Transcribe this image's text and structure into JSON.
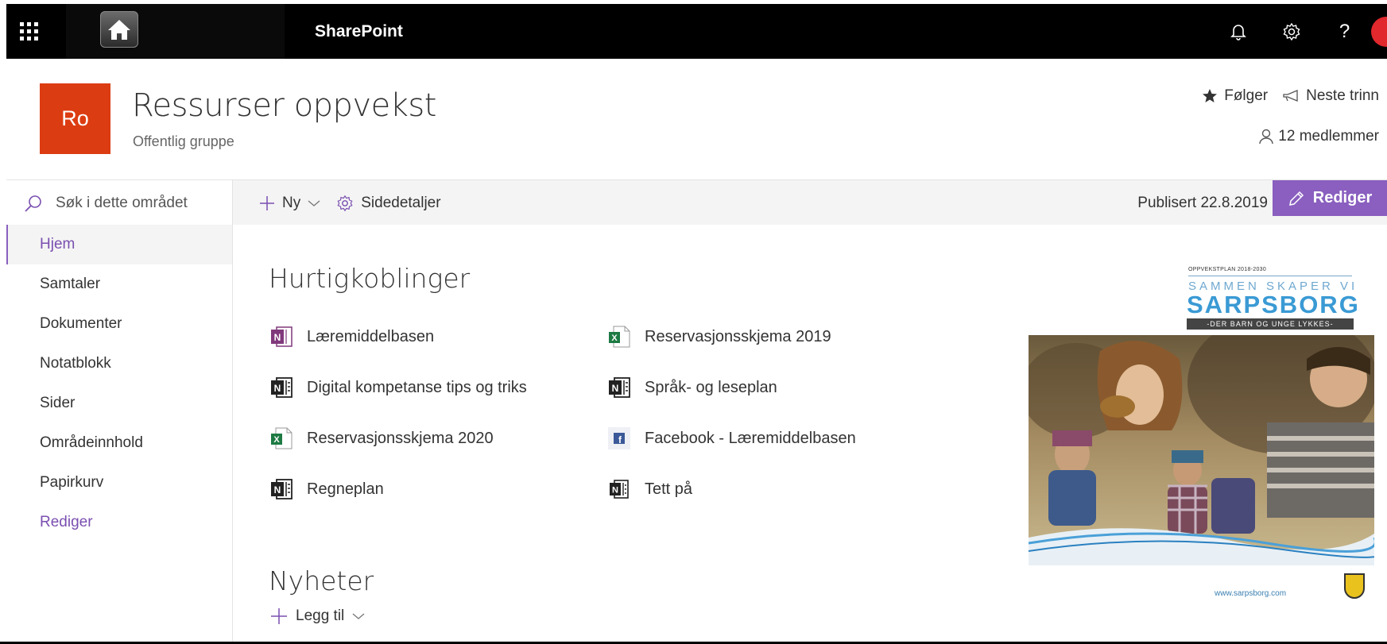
{
  "suitebar": {
    "title": "SharePoint",
    "icons": [
      "waffle-icon",
      "home-icon",
      "bell-icon",
      "gear-icon",
      "help-icon"
    ],
    "help_glyph": "?"
  },
  "site": {
    "logo_initials": "Ro",
    "logo_color": "#dc3c12",
    "title": "Ressurser oppvekst",
    "subtitle": "Offentlig gruppe",
    "follow_label": "Følger",
    "next_steps_label": "Neste trinn",
    "members_label": "12 medlemmer"
  },
  "commandbar": {
    "search_placeholder": "Søk i dette området",
    "new_label": "Ny",
    "page_details_label": "Sidedetaljer",
    "published_label": "Publisert 22.8.2019",
    "edit_label": "Rediger",
    "edit_color": "#8a5fbf"
  },
  "nav": {
    "items": [
      {
        "label": "Hjem",
        "active": true
      },
      {
        "label": "Samtaler"
      },
      {
        "label": "Dokumenter"
      },
      {
        "label": "Notatblokk"
      },
      {
        "label": "Sider"
      },
      {
        "label": "Områdeinnhold"
      },
      {
        "label": "Papirkurv"
      },
      {
        "label": "Rediger",
        "edit": true
      }
    ]
  },
  "quicklinks": {
    "heading": "Hurtigkoblinger",
    "links": [
      {
        "label": "Læremiddelbasen",
        "icon": "onenote-purple-icon"
      },
      {
        "label": "Reservasjonsskjema 2019",
        "icon": "excel-icon"
      },
      {
        "label": "Digital kompetanse tips og triks",
        "icon": "onenote-icon"
      },
      {
        "label": "Språk- og leseplan",
        "icon": "onenote-icon"
      },
      {
        "label": "Reservasjonsskjema 2020",
        "icon": "excel-icon"
      },
      {
        "label": "Facebook - Læremiddelbasen",
        "icon": "facebook-icon"
      },
      {
        "label": "Regneplan",
        "icon": "onenote-icon"
      },
      {
        "label": "Tett på",
        "icon": "onenote-icon"
      }
    ]
  },
  "news": {
    "heading": "Nyheter",
    "add_label": "Legg til"
  },
  "poster": {
    "top_small": "OPPVEKSTPLAN 2018-2030",
    "tagline_top": "SAMMEN SKAPER VI",
    "city": "SARPSBORG",
    "tagline_bottom": "-DER BARN OG UNGE LYKKES-",
    "url": "www.sarpsborg.com"
  }
}
